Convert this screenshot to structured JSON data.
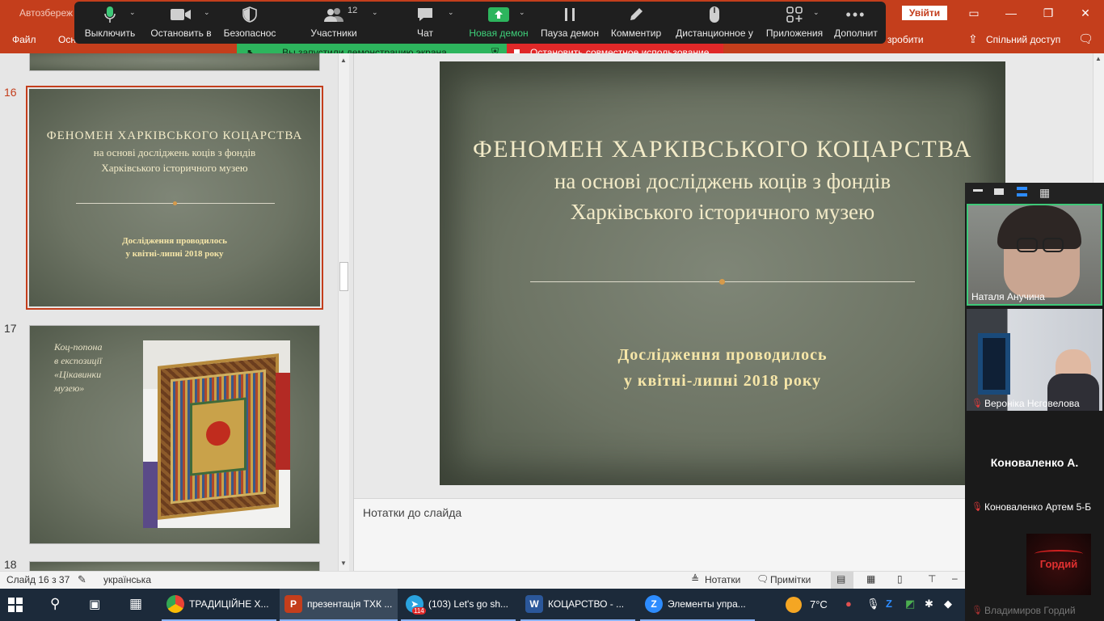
{
  "powerpoint": {
    "autosave_label": "Автозбереж",
    "tabs": [
      "Файл",
      "Осн"
    ],
    "help_text": "зробити",
    "login_button": "Увійти",
    "share_label": "Спільний доступ"
  },
  "zoom_toolbar": {
    "mute": "Выключить",
    "video": "Остановить в",
    "security": "Безопаснос",
    "participants": "Участники",
    "participants_count": "12",
    "chat": "Чат",
    "new_share": "Новая демон",
    "pause_share": "Пауза демон",
    "annotate": "Комментир",
    "remote_control": "Дистанционное у",
    "apps": "Приложения",
    "more": "Дополнит"
  },
  "share_banner": {
    "status": "Вы запустили демонстрацию экрана",
    "stop": "Остановить совместное использование"
  },
  "thumbnails": [
    {
      "number": "16",
      "selected": true
    },
    {
      "number": "17",
      "caption": [
        "Коц-попона",
        "в експозиції",
        "«Цікавинки",
        "музею»"
      ]
    },
    {
      "number": "18"
    }
  ],
  "slide": {
    "title_main": "ФЕНОМЕН   ХАРКІВСЬКОГО   КОЦАРСТВА",
    "title_sub1": "на основі досліджень коців з фондів",
    "title_sub2": "Харківського історичного музею",
    "thumb_sub1": "на основі досліджень коців з фондів",
    "research1": "Дослідження проводилось",
    "research2": "у квітні-липні 2018 року"
  },
  "notes": {
    "placeholder": "Нотатки до слайда"
  },
  "status_bar": {
    "slide_counter": "Слайд 16 з 37",
    "language": "українська",
    "notes_btn": "Нотатки",
    "comments_btn": "Примітки"
  },
  "video_panel": {
    "participants": [
      {
        "name": "Наталя Анучина",
        "muted": false
      },
      {
        "name": "Вероніка Нєговелова",
        "muted": true
      },
      {
        "name": "Коноваленко Артем 5-Б",
        "muted": true,
        "display": "Коноваленко  А."
      },
      {
        "name": "Владимиров Гордий",
        "muted": true,
        "display": "Гордий"
      }
    ]
  },
  "taskbar": {
    "apps": [
      {
        "label": "ТРАДИЦІЙНЕ Х..."
      },
      {
        "label": "презентація ТХК ..."
      },
      {
        "label": "(103) Let's go sh...",
        "badge": "114"
      },
      {
        "label": "КОЦАРСТВО - ..."
      },
      {
        "label": "Элементы упра..."
      }
    ],
    "weather": "7°C"
  },
  "colors": {
    "ppt_red": "#c43e1c",
    "zoom_bar": "#1f1f1f",
    "share_green": "#2db55d",
    "stop_red": "#e02828",
    "selected_border": "#c43e1c",
    "slide_text_yellow": "#f6e6a8"
  }
}
